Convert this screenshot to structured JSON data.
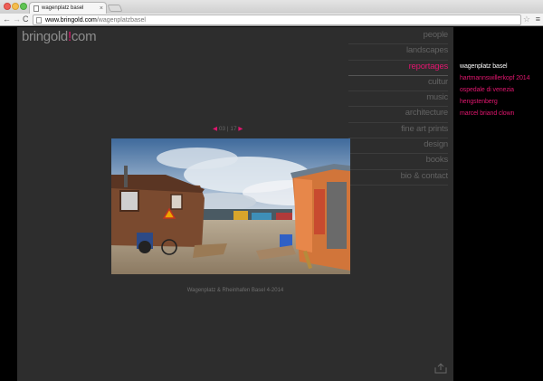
{
  "browser": {
    "tab_title": "wagenplatz basel",
    "tab_close": "×",
    "url_host": "www.bringold.com",
    "url_path": "/wagenplatzbasel",
    "back": "←",
    "forward": "→",
    "reload": "C",
    "star": "☆",
    "menu": "≡"
  },
  "site": {
    "logo_text": "bringold",
    "logo_mark": "!",
    "logo_suffix": "com",
    "nav": [
      {
        "label": "people"
      },
      {
        "label": "landscapes"
      },
      {
        "label": "reportages",
        "active": true
      },
      {
        "label": "cultur"
      },
      {
        "label": "music"
      },
      {
        "label": "architecture"
      },
      {
        "label": "fine art prints"
      },
      {
        "label": "design"
      },
      {
        "label": "books"
      },
      {
        "label": "bio & contact"
      }
    ],
    "submenu": [
      {
        "label": "wagenplatz basel"
      },
      {
        "label": "hartmannswillerkopf 2014"
      },
      {
        "label": "ospedale di venezia"
      },
      {
        "label": "hengstenberg"
      },
      {
        "label": "marcel briand clown"
      }
    ],
    "pager": {
      "prev": "◀",
      "current": "03",
      "separator": "|",
      "total": "17",
      "next": "▶"
    },
    "caption": "Wagenplatz & Rheinhafen Basel 4-2014"
  },
  "colors": {
    "accent": "#e0166e",
    "background": "#2d2d2d",
    "nav_text": "#626262"
  }
}
